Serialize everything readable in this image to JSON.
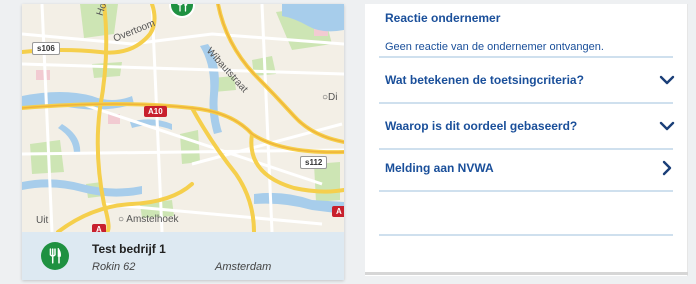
{
  "map": {
    "labels": {
      "ovortoom": "Overtoom",
      "hoofdweg": "Hoofdweg",
      "wibautstraat": "Wibautstraat",
      "amstelhoek": "Amstelhoek",
      "uit": "Uit",
      "di": "Di"
    },
    "shields": {
      "s106": "s106",
      "a10": "A10",
      "s112": "s112",
      "a_bottom": "A",
      "a_right": "A"
    },
    "pin_icon": "fork-knife-icon"
  },
  "business": {
    "name": "Test bedrijf 1",
    "street": "Rokin 62",
    "city": "Amsterdam",
    "icon": "fork-knife-icon",
    "color": "#1f9141"
  },
  "panel": {
    "reaction_title": "Reactie ondernemer",
    "reaction_text": "Geen reactie van de ondernemer ontvangen.",
    "items": [
      {
        "label": "Wat betekenen de toetsingcriteria?",
        "icon": "chevron-down-icon"
      },
      {
        "label": "Waarop is dit oordeel gebaseerd?",
        "icon": "chevron-down-icon"
      },
      {
        "label": "Melding aan NVWA",
        "icon": "chevron-right-icon"
      }
    ],
    "accent_color": "#1a4f9a"
  }
}
